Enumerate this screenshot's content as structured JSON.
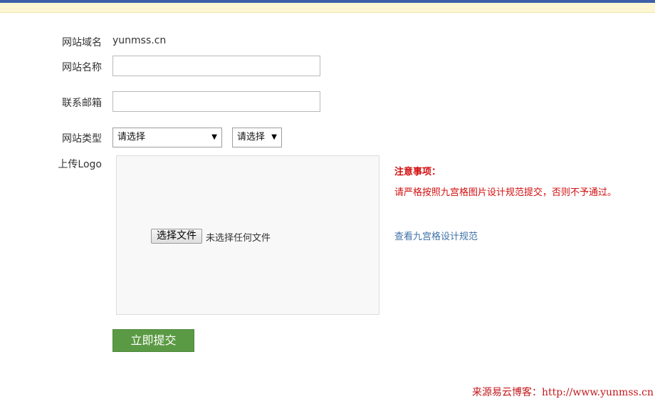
{
  "form": {
    "domain_label": "网站域名",
    "domain_value": "yunmss.cn",
    "name_label": "网站名称",
    "name_value": "",
    "email_label": "联系邮箱",
    "email_value": "",
    "type_label": "网站类型",
    "type_select_primary": "请选择",
    "type_select_secondary": "请选择",
    "logo_label": "上传Logo",
    "file_button_label": "选择文件",
    "file_status": "未选择任何文件",
    "submit_label": "立即提交"
  },
  "notice": {
    "title": "注意事项：",
    "text": "请严格按照九宫格图片设计规范提交，否则不予通过。",
    "link_label": "查看九宫格设计规范"
  },
  "watermark": "来源易云博客：http://www.yunmss.cn",
  "colors": {
    "accent_blue": "#3d5fa8",
    "header_band": "#fdf6d3",
    "notice_red": "#d20f0f",
    "link_blue": "#3e6fa6",
    "submit_green": "#5b9a44"
  },
  "icons": {
    "select_arrow": "caret-down-icon"
  }
}
